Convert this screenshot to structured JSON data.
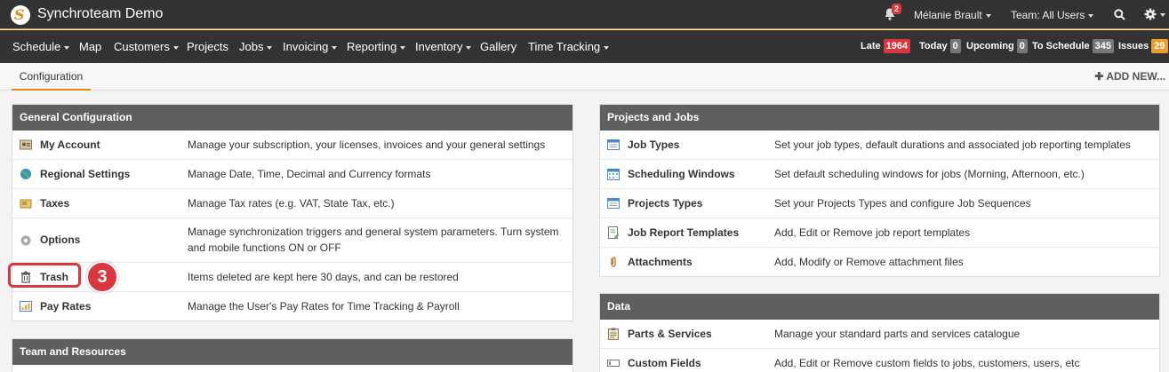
{
  "app": {
    "title": "Synchroteam Demo",
    "logo_letter": "S"
  },
  "topbar": {
    "notifications_count": "2",
    "user_label": "Mélanie Brault",
    "team_label": "Team: All Users"
  },
  "menu": {
    "items": [
      "Schedule",
      "Map",
      "Customers",
      "Projects",
      "Jobs",
      "Invoicing",
      "Reporting",
      "Inventory",
      "Gallery",
      "Time Tracking"
    ],
    "stats": [
      {
        "label": "Late",
        "value": "1964",
        "color": "#d9363e"
      },
      {
        "label": "Today",
        "value": "0",
        "color": "#777777"
      },
      {
        "label": "Upcoming",
        "value": "0",
        "color": "#777777"
      },
      {
        "label": "To Schedule",
        "value": "345",
        "color": "#777777"
      },
      {
        "label": "Issues",
        "value": "29",
        "color": "#e8a02a"
      }
    ]
  },
  "tabs": {
    "active": "Configuration",
    "add_new": "ADD NEW..."
  },
  "general": {
    "title": "General Configuration",
    "rows": [
      {
        "label": "My Account",
        "desc": "Manage your subscription, your licenses, invoices and your general settings"
      },
      {
        "label": "Regional Settings",
        "desc": "Manage Date, Time, Decimal and Currency formats"
      },
      {
        "label": "Taxes",
        "desc": "Manage Tax rates (e.g. VAT, State Tax, etc.)"
      },
      {
        "label": "Options",
        "desc": "Manage synchronization triggers and general system parameters. Turn system and mobile functions ON or OFF"
      },
      {
        "label": "Trash",
        "desc": "Items deleted are kept here 30 days, and can be restored"
      },
      {
        "label": "Pay Rates",
        "desc": "Manage the User's Pay Rates for Time Tracking & Payroll"
      }
    ]
  },
  "team": {
    "title": "Team and Resources"
  },
  "projects": {
    "title": "Projects and Jobs",
    "rows": [
      {
        "label": "Job Types",
        "desc": "Set your job types, default durations and associated job reporting templates"
      },
      {
        "label": "Scheduling Windows",
        "desc": "Set default scheduling windows for jobs (Morning, Afternoon, etc.)"
      },
      {
        "label": "Projects Types",
        "desc": "Set your Projects Types and configure Job Sequences"
      },
      {
        "label": "Job Report Templates",
        "desc": "Add, Edit or Remove job report templates"
      },
      {
        "label": "Attachments",
        "desc": "Add, Modify or Remove attachment files"
      }
    ]
  },
  "data_panel": {
    "title": "Data",
    "rows": [
      {
        "label": "Parts & Services",
        "desc": "Manage your standard parts and services catalogue"
      },
      {
        "label": "Custom Fields",
        "desc": "Add, Edit or Remove custom fields to jobs, customers, users, etc"
      }
    ]
  },
  "callout": {
    "step": "3"
  },
  "icons": {
    "general": [
      "account-icon",
      "globe-icon",
      "taxes-icon",
      "options-gear-icon",
      "trash-icon",
      "pay-rates-icon"
    ],
    "projects": [
      "job-types-icon",
      "calendar-icon",
      "project-types-icon",
      "report-template-icon",
      "attachment-icon"
    ],
    "data": [
      "clipboard-icon",
      "custom-fields-icon"
    ]
  }
}
